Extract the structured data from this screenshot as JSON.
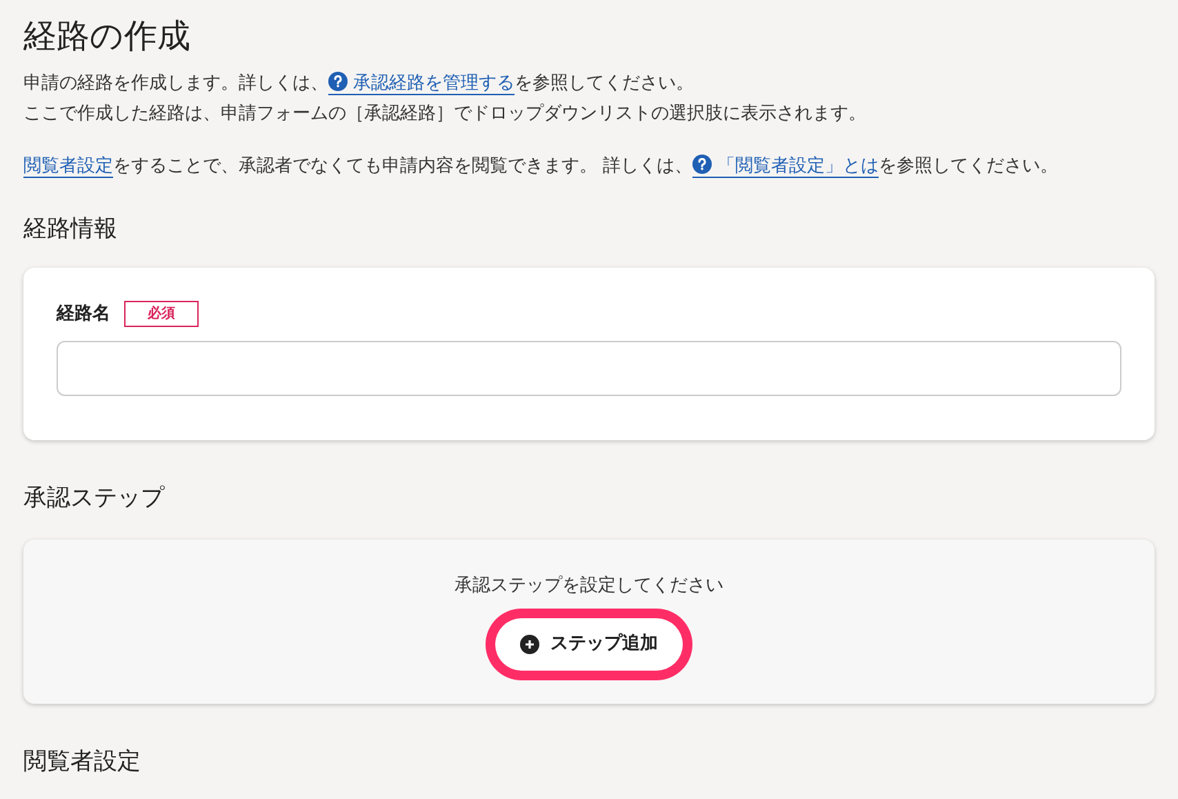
{
  "title": "経路の作成",
  "intro": [
    [
      {
        "kind": "text",
        "text": "申請の経路を作成します。詳しくは、"
      },
      {
        "kind": "link",
        "help": true,
        "text": "承認経路を管理する"
      },
      {
        "kind": "text",
        "text": "を参照してください。"
      }
    ],
    [
      {
        "kind": "text",
        "text": "ここで作成した経路は、申請フォームの［承認経路］でドロップダウンリストの選択肢に表示されます。"
      }
    ],
    [
      {
        "kind": "link",
        "help": false,
        "text": "閲覧者設定"
      },
      {
        "kind": "text",
        "text": "をすることで、承認者でなくても申請内容を閲覧できます。 詳しくは、"
      },
      {
        "kind": "link",
        "help": true,
        "text": "「閲覧者設定」とは"
      },
      {
        "kind": "text",
        "text": "を参照してください。"
      }
    ]
  ],
  "route_info": {
    "heading": "経路情報",
    "field": {
      "label": "経路名",
      "badge": "必須"
    }
  },
  "steps": {
    "heading": "承認ステップ",
    "message": "承認ステップを設定してください",
    "button": {
      "label": "ステップ追加",
      "highlighted": true
    }
  },
  "viewers": {
    "heading": "閲覧者設定"
  }
}
